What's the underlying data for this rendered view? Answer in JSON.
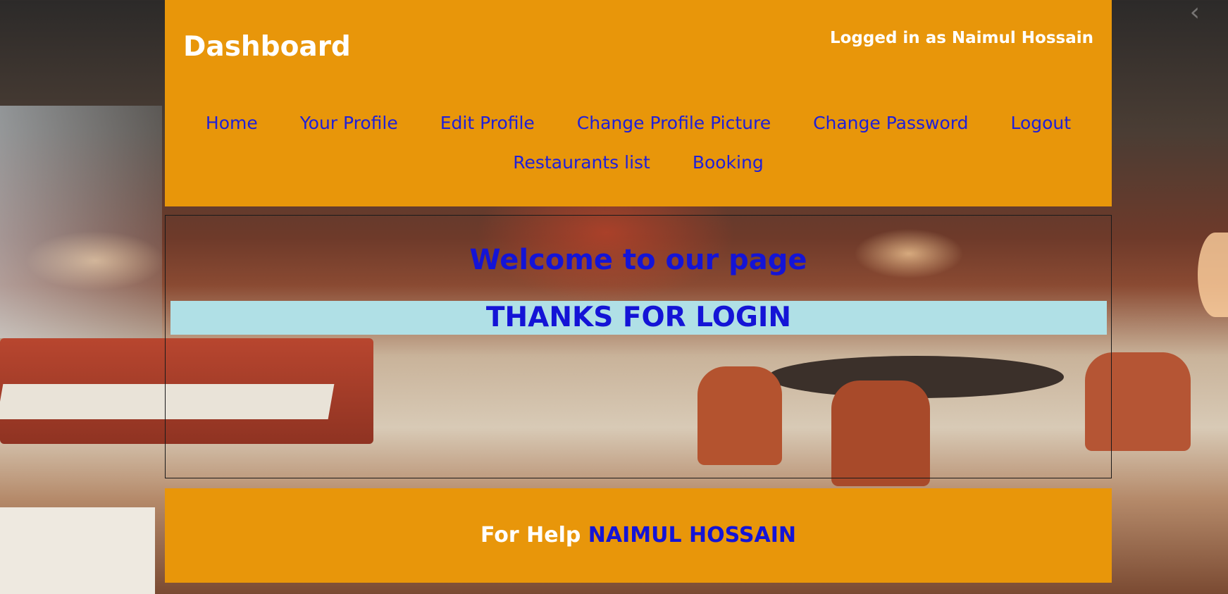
{
  "header": {
    "title": "Dashboard",
    "logged_in_text": "Logged in as Naimul Hossain"
  },
  "nav": {
    "row1": [
      "Home",
      "Your Profile",
      "Edit Profile",
      "Change Profile Picture",
      "Change Password",
      "Logout"
    ],
    "row2": [
      "Restaurants list",
      "Booking"
    ]
  },
  "main": {
    "welcome": "Welcome to our page",
    "thanks": "THANKS FOR LOGIN"
  },
  "footer": {
    "help_label": "For Help",
    "contact_name": "NAIMUL HOSSAIN"
  },
  "colors": {
    "header_bg": "#e8960a",
    "link": "#2020d8",
    "banner_bg": "#b0e0e6"
  },
  "icons": {
    "back": "chevron-left-icon"
  }
}
